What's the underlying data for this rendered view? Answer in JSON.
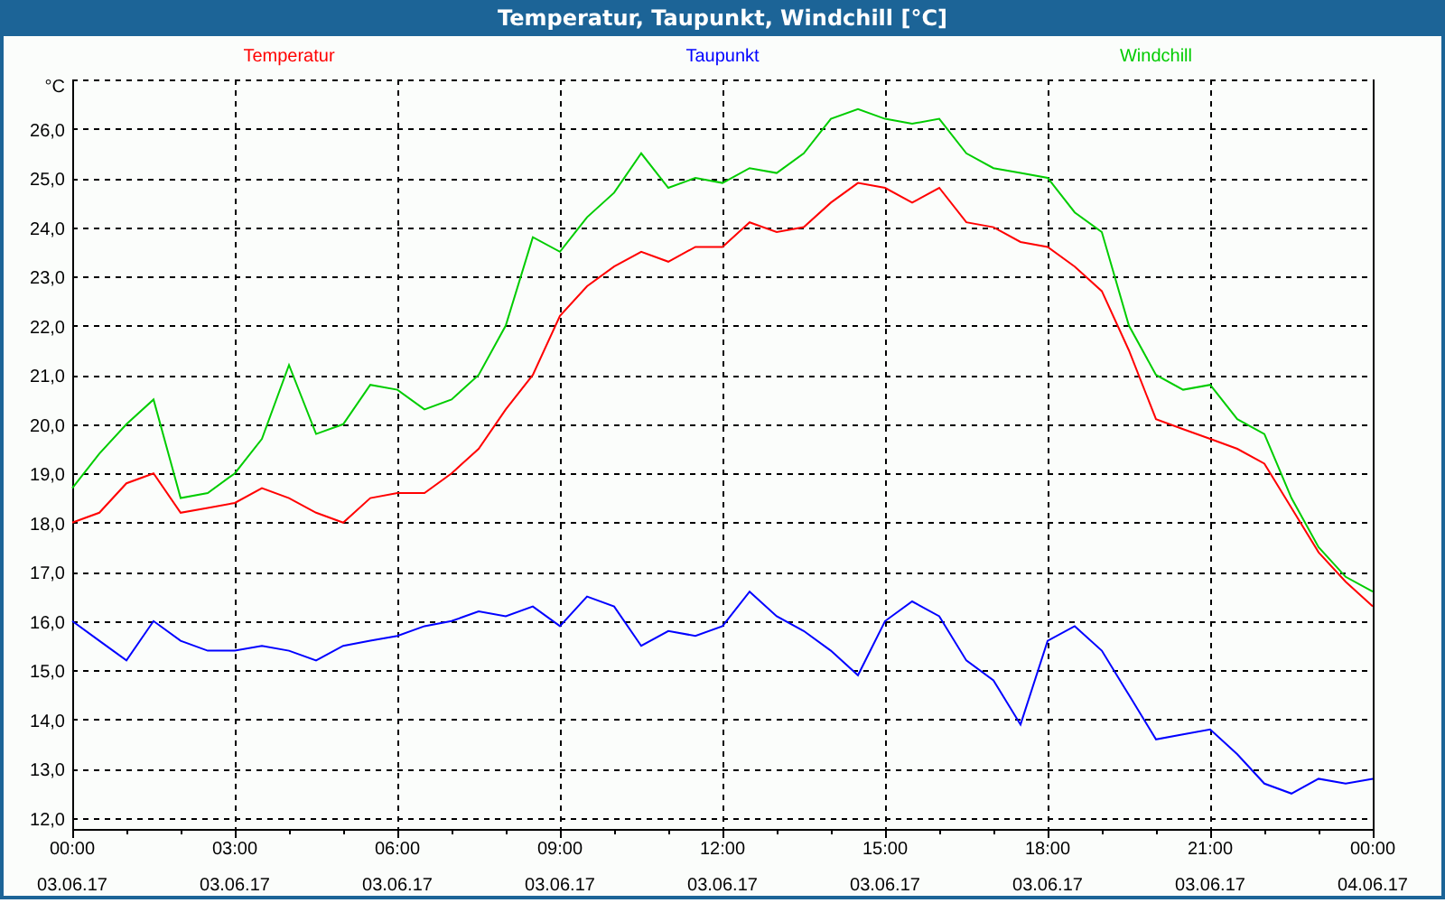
{
  "chart": {
    "xtick_dates": [
      "03.06.17",
      "03.06.17",
      "03.06.17",
      "03.06.17",
      "03.06.17",
      "03.06.17",
      "03.06.17",
      "03.06.17",
      "04.06.17"
    ],
    "chart_data": {
      "type": "line",
      "title": "Temperatur, Taupunkt, Windchill [°C]",
      "ylabel": "°C",
      "x": [
        0,
        0.5,
        1,
        1.5,
        2,
        2.5,
        3,
        3.5,
        4,
        4.5,
        5,
        5.5,
        6,
        6.5,
        7,
        7.5,
        8,
        8.5,
        9,
        9.5,
        10,
        10.5,
        11,
        11.5,
        12,
        12.5,
        13,
        13.5,
        14,
        14.5,
        15,
        15.5,
        16,
        16.5,
        17,
        17.5,
        18,
        18.5,
        19,
        19.5,
        20,
        20.5,
        21,
        21.5,
        22,
        22.5,
        23,
        23.5,
        24
      ],
      "series": [
        {
          "name": "Temperatur",
          "color": "#ff0000",
          "values": [
            18.0,
            18.2,
            18.8,
            19.0,
            18.2,
            18.3,
            18.4,
            18.7,
            18.5,
            18.2,
            18.0,
            18.5,
            18.6,
            18.6,
            19.0,
            19.5,
            20.3,
            21.0,
            22.2,
            22.8,
            23.2,
            23.5,
            23.3,
            23.6,
            23.6,
            24.1,
            23.9,
            24.0,
            24.5,
            24.9,
            24.8,
            24.5,
            24.8,
            24.1,
            24.0,
            23.7,
            23.6,
            23.2,
            22.7,
            21.5,
            20.1,
            19.9,
            19.7,
            19.5,
            19.2,
            18.3,
            17.4,
            16.8,
            16.3
          ]
        },
        {
          "name": "Taupunkt",
          "color": "#0000ff",
          "values": [
            16.0,
            15.6,
            15.2,
            16.0,
            15.6,
            15.4,
            15.4,
            15.5,
            15.4,
            15.2,
            15.5,
            15.6,
            15.7,
            15.9,
            16.0,
            16.2,
            16.1,
            16.3,
            15.9,
            16.5,
            16.3,
            15.5,
            15.8,
            15.7,
            15.9,
            16.6,
            16.1,
            15.8,
            15.4,
            14.9,
            16.0,
            16.4,
            16.1,
            15.2,
            14.8,
            13.9,
            15.6,
            15.9,
            15.4,
            14.5,
            13.6,
            13.7,
            13.8,
            13.3,
            12.7,
            12.5,
            12.8,
            12.7,
            12.8
          ]
        },
        {
          "name": "Windchill",
          "color": "#00cc00",
          "values": [
            18.7,
            19.4,
            20.0,
            20.5,
            18.5,
            18.6,
            19.0,
            19.7,
            21.2,
            19.8,
            20.0,
            20.8,
            20.7,
            20.3,
            20.5,
            21.0,
            22.0,
            23.8,
            23.5,
            24.2,
            24.7,
            25.5,
            24.8,
            25.0,
            24.9,
            25.2,
            25.1,
            25.5,
            26.2,
            26.4,
            26.2,
            26.1,
            26.2,
            25.5,
            25.2,
            25.1,
            25.0,
            24.3,
            23.9,
            22.0,
            21.0,
            20.7,
            20.8,
            20.1,
            19.8,
            18.5,
            17.5,
            16.9,
            16.6
          ]
        }
      ],
      "grid": true,
      "xlim": [
        0,
        24
      ],
      "ylim": [
        11.78,
        27.0
      ],
      "xticks": [
        {
          "value": 0,
          "label": "00:00"
        },
        {
          "value": 3,
          "label": "03:00"
        },
        {
          "value": 6,
          "label": "06:00"
        },
        {
          "value": 9,
          "label": "09:00"
        },
        {
          "value": 12,
          "label": "12:00"
        },
        {
          "value": 15,
          "label": "15:00"
        },
        {
          "value": 18,
          "label": "18:00"
        },
        {
          "value": 21,
          "label": "21:00"
        },
        {
          "value": 24,
          "label": "00:00"
        }
      ],
      "yticks": [
        {
          "value": 12,
          "label": "12,0"
        },
        {
          "value": 13,
          "label": "13,0"
        },
        {
          "value": 14,
          "label": "14,0"
        },
        {
          "value": 15,
          "label": "15,0"
        },
        {
          "value": 16,
          "label": "16,0"
        },
        {
          "value": 17,
          "label": "17,0"
        },
        {
          "value": 18,
          "label": "18,0"
        },
        {
          "value": 19,
          "label": "19,0"
        },
        {
          "value": 20,
          "label": "20,0"
        },
        {
          "value": 21,
          "label": "21,0"
        },
        {
          "value": 22,
          "label": "22,0"
        },
        {
          "value": 23,
          "label": "23,0"
        },
        {
          "value": 24,
          "label": "24,0"
        },
        {
          "value": 25,
          "label": "25,0"
        },
        {
          "value": 26,
          "label": "26,0"
        }
      ]
    }
  }
}
